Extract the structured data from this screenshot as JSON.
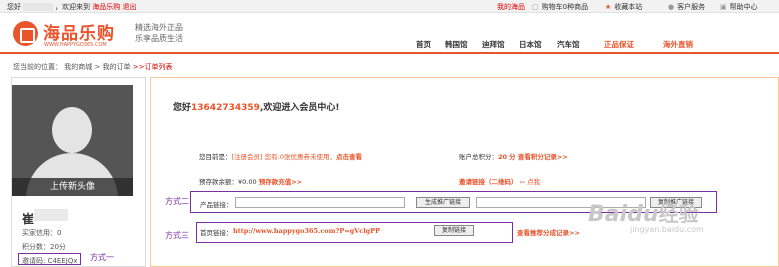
{
  "topbar": {
    "greet_prefix": "您好",
    "greet_mid": "，欢迎来到",
    "site": "海品乐购",
    "logout": "退出",
    "my_haipin": "我的海品",
    "cart": "购物车0种商品",
    "favorite": "收藏本站",
    "service": "客户服务",
    "help": "帮助中心"
  },
  "header": {
    "logo": "海品乐购",
    "logo_url": "WWW.HAPPYGO365.COM",
    "slogan1": "精选海外正品",
    "slogan2": "乐享品质生活",
    "nav": [
      "首页",
      "韩国馆",
      "迪拜馆",
      "日本馆",
      "汽车馆",
      "正品保证",
      "海外直销"
    ]
  },
  "breadcrumb": {
    "prefix": "您当前的位置：",
    "items": [
      "我的商城",
      "我的订单"
    ],
    "current": "订单列表"
  },
  "sidebar": {
    "upload": "上传新头像",
    "name": "崔",
    "credit": "买家信用：0",
    "points": "积分数：20分",
    "invite": "邀请码: C4EEJQx"
  },
  "main": {
    "welcome_prefix": "您好",
    "phone": "13642734359",
    "welcome_suffix": ",欢迎进入会员中心!",
    "level_label": "您目前是：",
    "level": "[注册会员]",
    "coupon": "您有:0张优惠券未使用，",
    "coupon_link": "点击查看",
    "total_points": "账户总积分：",
    "total_points_value": "20",
    "points_link": "分 查看积分记录>>",
    "deposit_label": "预存款余额：",
    "deposit_value": "¥0.00",
    "deposit_link": "预存款充值>>",
    "invite_link": "邀请链接（二维码）",
    "invite_click": "⇦ 点我",
    "product_link_label": "产品链接：",
    "generate_btn": "生成推广链接",
    "copy_btn1": "复制推广链接",
    "home_link_label": "首页链接：",
    "home_url": "http://www.happygo365.com?P=gVclgPP",
    "copy_btn2": "复制链接",
    "share_link": "查看推荐分成记录>>"
  },
  "annotations": {
    "a1": "方式一",
    "a2": "方式二",
    "a3": "方式三"
  },
  "watermark": {
    "logo": "Baidu",
    "sub": "经验",
    "url": "jingyan.baidu.com"
  }
}
